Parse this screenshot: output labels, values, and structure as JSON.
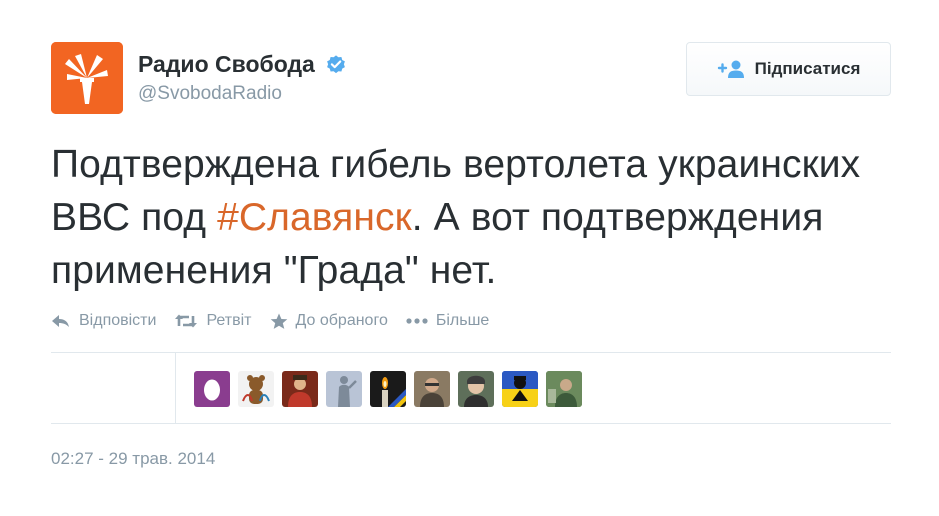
{
  "author": {
    "display_name": "Радио Свобода",
    "screen_name": "@SvobodaRadio",
    "verified": true,
    "avatar_icon": "torch-logo-icon",
    "avatar_color": "#f26522"
  },
  "follow_button": {
    "label": "Підписатися",
    "icon": "follow-user-icon"
  },
  "tweet": {
    "text_before": "Подтверждена гибель вертолета украинских ВВС под ",
    "hashtag": "#Славянск",
    "text_after": ". А вот подтверждения применения \"Града\" нет.",
    "hashtag_color": "#d9672a"
  },
  "actions": [
    {
      "label": "Відповісти",
      "icon": "reply-icon"
    },
    {
      "label": "Ретвіт",
      "icon": "retweet-icon"
    },
    {
      "label": "До обраного",
      "icon": "star-icon"
    },
    {
      "label": "Більше",
      "icon": "more-icon"
    }
  ],
  "favoriters": [
    {
      "icon": "default-egg-avatar-icon",
      "color": "#8a3d8f"
    },
    {
      "icon": "olympic-bear-avatar-icon",
      "color": "#f2f2f2"
    },
    {
      "icon": "user-avatar-icon",
      "color": "#7a2a1a"
    },
    {
      "icon": "statue-avatar-icon",
      "color": "#b9c4d6"
    },
    {
      "icon": "candle-avatar-icon",
      "color": "#1a1a1a"
    },
    {
      "icon": "user-avatar-icon",
      "color": "#8a7a63"
    },
    {
      "icon": "user-avatar-icon",
      "color": "#5e6f5a"
    },
    {
      "icon": "ukraine-flag-avatar-icon",
      "color": "#2b59c3"
    },
    {
      "icon": "user-avatar-icon",
      "color": "#6b8a5d"
    }
  ],
  "timestamp": "02:27 - 29 трав. 2014"
}
